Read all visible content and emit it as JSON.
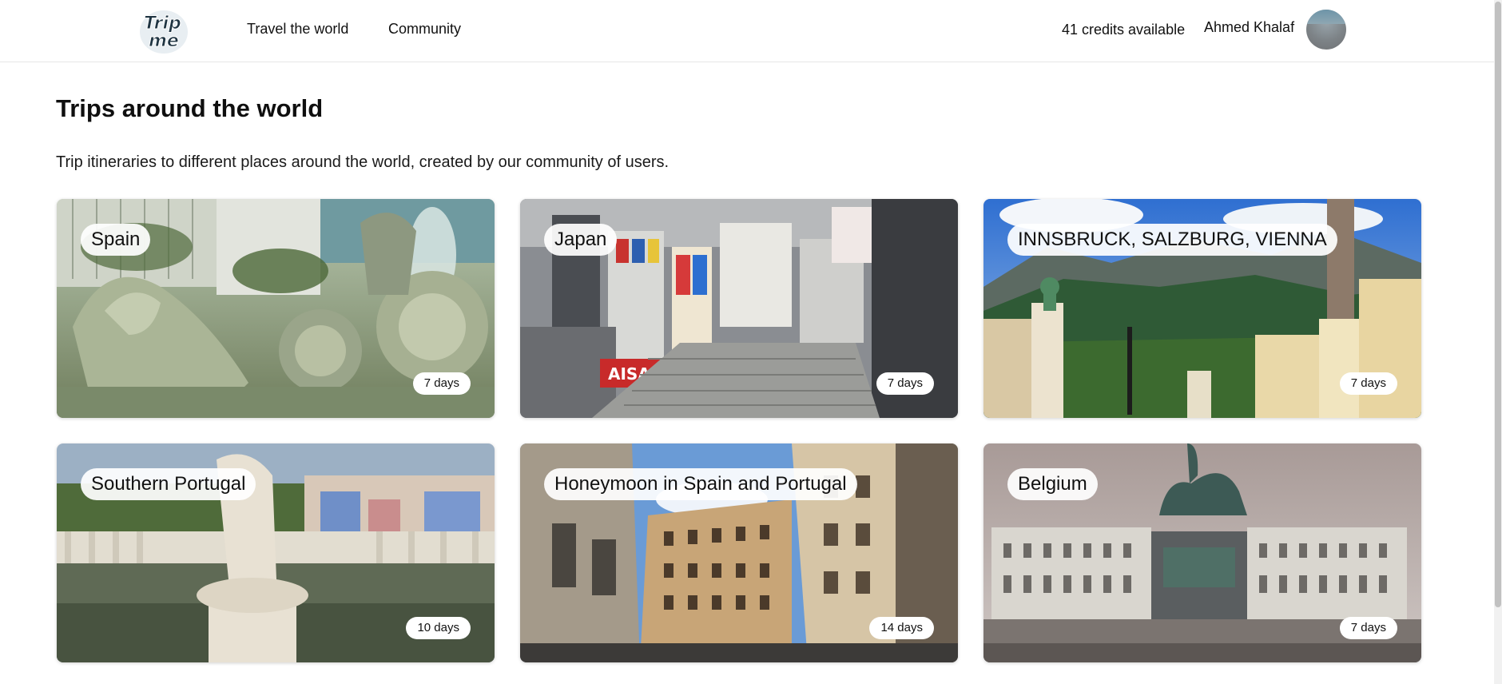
{
  "header": {
    "logo_text": "Trip me",
    "nav": [
      {
        "label": "Travel the world"
      },
      {
        "label": "Community"
      }
    ],
    "credits": "41 credits available",
    "user_name": "Ahmed Khalaf"
  },
  "main": {
    "title": "Trips around the world",
    "subtitle": "Trip itineraries to different places around the world, created by our community of users."
  },
  "trips": [
    {
      "title": "Spain",
      "duration": "7 days"
    },
    {
      "title": "Japan",
      "duration": "7 days"
    },
    {
      "title": "INNSBRUCK, SALZBURG, VIENNA",
      "duration": "7 days"
    },
    {
      "title": "Southern Portugal",
      "duration": "10 days"
    },
    {
      "title": "Honeymoon in Spain and Portugal",
      "duration": "14 days"
    },
    {
      "title": "Belgium",
      "duration": "7 days"
    }
  ],
  "colors": {
    "text": "#111111",
    "divider": "#e6e6e6",
    "badge_bg": "#ffffff"
  }
}
